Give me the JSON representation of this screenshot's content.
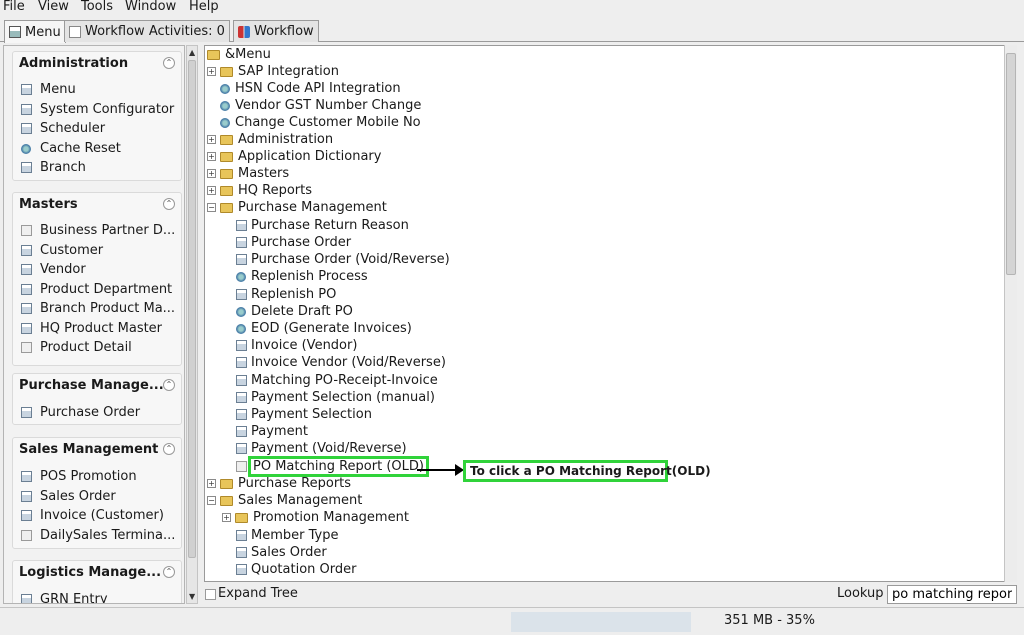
{
  "menubar": {
    "file": "File",
    "view": "View",
    "tools": "Tools",
    "window": "Window",
    "help": "Help"
  },
  "tabs": [
    {
      "label": "Menu",
      "icon": "menu-icon"
    },
    {
      "label": "Workflow Activities: 0",
      "icon": "document-icon"
    },
    {
      "label": "Workflow",
      "icon": "workflow-icon"
    }
  ],
  "sidebar": {
    "administration": {
      "title": "Administration",
      "items": [
        "Menu",
        "System Configurator",
        "Scheduler",
        "Cache Reset",
        "Branch"
      ]
    },
    "masters": {
      "title": "Masters",
      "items": [
        "Business Partner D...",
        "Customer",
        "Vendor",
        "Product Department",
        "Branch Product Ma...",
        "HQ Product Master",
        "Product Detail"
      ]
    },
    "purchase": {
      "title": "Purchase Manage...",
      "items": [
        "Purchase Order"
      ]
    },
    "sales": {
      "title": "Sales Management",
      "items": [
        "POS Promotion",
        "Sales Order",
        "Invoice (Customer)",
        "DailySales Termina..."
      ]
    },
    "logistics": {
      "title": "Logistics Manage...",
      "items": [
        "GRN Entry"
      ]
    }
  },
  "tree": {
    "root": "&Menu",
    "level1": [
      "SAP Integration",
      "HSN Code API Integration",
      "Vendor GST Number Change",
      "Change Customer Mobile No",
      "Administration",
      "Application Dictionary",
      "Masters",
      "HQ Reports",
      "Purchase Management"
    ],
    "purchase_children": [
      "Purchase Return Reason",
      "Purchase Order",
      "Purchase Order (Void/Reverse)",
      "Replenish Process",
      "Replenish PO",
      "Delete Draft PO",
      "EOD (Generate Invoices)",
      "Invoice (Vendor)",
      "Invoice Vendor (Void/Reverse)",
      "Matching PO-Receipt-Invoice",
      "Payment Selection (manual)",
      "Payment Selection",
      "Payment",
      "Payment (Void/Reverse)",
      "PO Matching Report (OLD)"
    ],
    "after": [
      "Purchase Reports",
      "Sales Management"
    ],
    "sales_children": [
      "Promotion Management",
      "Member Type",
      "Sales Order",
      "Quotation Order"
    ]
  },
  "annotation": "To click a PO Matching Report(OLD)",
  "bottom": {
    "expand_tree": "Expand Tree",
    "lookup_label": "Lookup",
    "lookup_value": "po matching report"
  },
  "status": {
    "memory": "351 MB - 35%"
  },
  "colors": {
    "highlight": "#30d33a",
    "folder": "#e8c55a"
  }
}
